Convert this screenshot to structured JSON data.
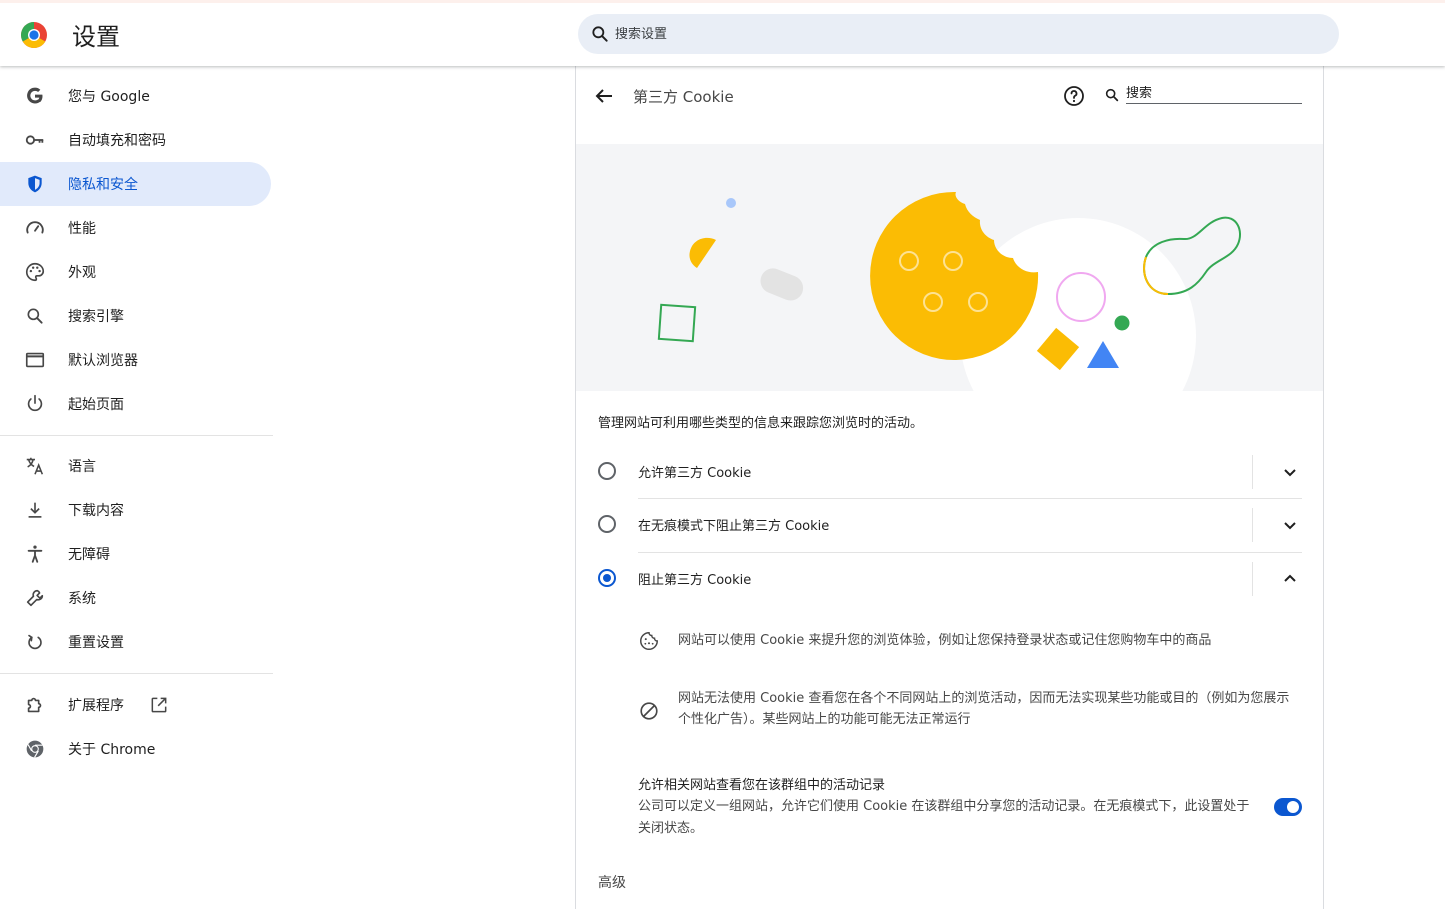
{
  "header": {
    "title": "设置",
    "search_placeholder": "搜索设置"
  },
  "sidebar": {
    "items": [
      {
        "label": "您与 Google",
        "icon": "google-g-icon"
      },
      {
        "label": "自动填充和密码",
        "icon": "key-icon"
      },
      {
        "label": "隐私和安全",
        "icon": "shield-icon",
        "active": true
      },
      {
        "label": "性能",
        "icon": "speedometer-icon"
      },
      {
        "label": "外观",
        "icon": "palette-icon"
      },
      {
        "label": "搜索引擎",
        "icon": "search-icon"
      },
      {
        "label": "默认浏览器",
        "icon": "browser-window-icon"
      },
      {
        "label": "起始页面",
        "icon": "power-icon"
      },
      {
        "label": "语言",
        "icon": "translate-icon"
      },
      {
        "label": "下载内容",
        "icon": "download-icon"
      },
      {
        "label": "无障碍",
        "icon": "accessibility-icon"
      },
      {
        "label": "系统",
        "icon": "wrench-icon"
      },
      {
        "label": "重置设置",
        "icon": "reset-icon"
      },
      {
        "label": "扩展程序",
        "icon": "puzzle-icon",
        "external": true
      },
      {
        "label": "关于 Chrome",
        "icon": "chrome-icon"
      }
    ]
  },
  "panel": {
    "title": "第三方 Cookie",
    "search_placeholder": "搜索",
    "description": "管理网站可利用哪些类型的信息来跟踪您浏览时的活动。",
    "options": [
      {
        "label": "允许第三方 Cookie",
        "selected": false,
        "expanded": false
      },
      {
        "label": "在无痕模式下阻止第三方 Cookie",
        "selected": false,
        "expanded": false
      },
      {
        "label": "阻止第三方 Cookie",
        "selected": true,
        "expanded": true
      }
    ],
    "details": [
      {
        "icon": "cookie-icon",
        "text": "网站可以使用 Cookie 来提升您的浏览体验，例如让您保持登录状态或记住您购物车中的商品"
      },
      {
        "icon": "block-icon",
        "text": "网站无法使用 Cookie 查看您在各个不同网站上的浏览活动，因而无法实现某些功能或目的（例如为您展示个性化广告）。某些网站上的功能可能无法正常运行"
      }
    ],
    "related_sites": {
      "title": "允许相关网站查看您在该群组中的活动记录",
      "description": "公司可以定义一组网站，允许它们使用 Cookie 在该群组中分享您的活动记录。在无痕模式下，此设置处于关闭状态。",
      "enabled": true
    },
    "advanced_label": "高级"
  },
  "colors": {
    "accent": "#0b57d0",
    "active_nav_bg": "#e1eafb",
    "search_bg": "#e9eef6",
    "cookie_yellow": "#fbbc04",
    "green": "#34a853",
    "blue": "#4285f4"
  }
}
